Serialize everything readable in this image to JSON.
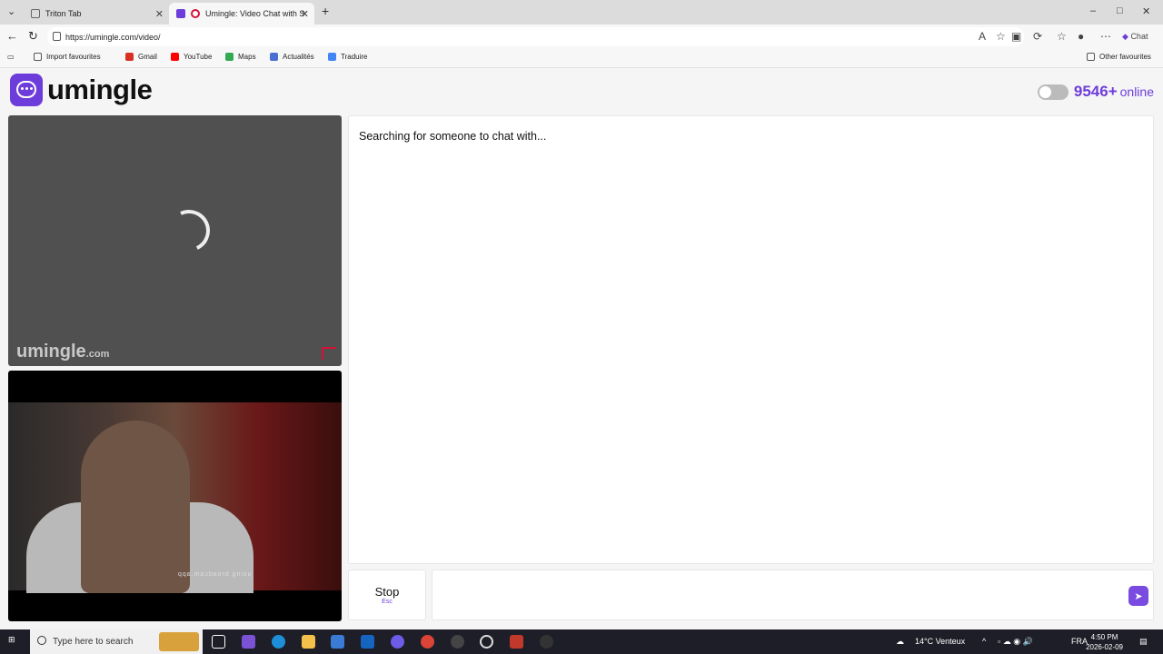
{
  "browser": {
    "tabs": [
      {
        "title": "Triton Tab",
        "active": false
      },
      {
        "title": "Umingle: Video Chat with Str",
        "active": true
      }
    ],
    "url": "https://umingle.com/video/",
    "profile_label": "Chat",
    "bookmarks": [
      {
        "label": "Import favourites",
        "color": "#555555"
      },
      {
        "label": "Gmail",
        "color": "#d93025"
      },
      {
        "label": "YouTube",
        "color": "#ff0000"
      },
      {
        "label": "Maps",
        "color": "#34a853"
      },
      {
        "label": "Actualités",
        "color": "#4a6fd0"
      },
      {
        "label": "Traduire",
        "color": "#4285f4"
      }
    ],
    "other_favourites": "Other favourites"
  },
  "app": {
    "brand": "umingle",
    "brand_color": "#6d3ddb",
    "online_count": "9546+",
    "online_label": "online",
    "watermark": "umingle",
    "watermark_suffix": ".com",
    "self_caption": "using broadcam.app",
    "status": "Searching for someone to chat with...",
    "stop_label": "Stop",
    "stop_key": "Esc"
  },
  "taskbar": {
    "search_placeholder": "Type here to search",
    "weather": "14°C Venteux",
    "language": "FRA",
    "time": "4:50 PM",
    "date": "2026-02-09"
  }
}
